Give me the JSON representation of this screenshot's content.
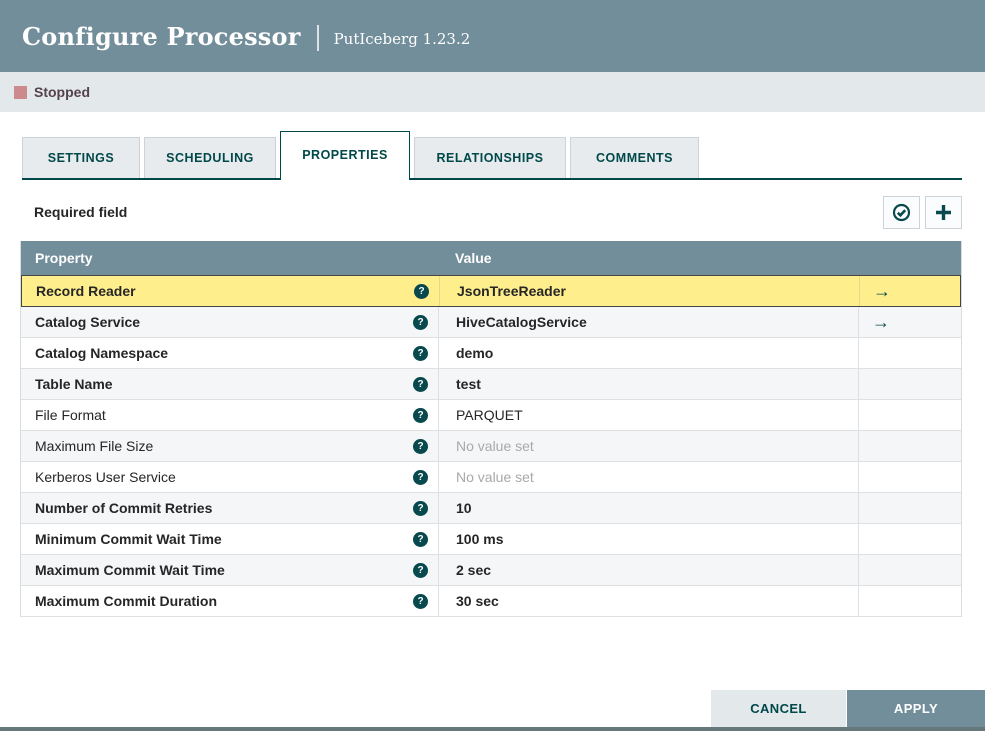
{
  "dialog": {
    "title": "Configure Processor",
    "subtitle": "PutIceberg 1.23.2"
  },
  "status": {
    "label": "Stopped",
    "color": "#CC8A8D"
  },
  "tabs": [
    {
      "label": "SETTINGS",
      "active": false
    },
    {
      "label": "SCHEDULING",
      "active": false
    },
    {
      "label": "PROPERTIES",
      "active": true
    },
    {
      "label": "RELATIONSHIPS",
      "active": false
    },
    {
      "label": "COMMENTS",
      "active": false
    }
  ],
  "toolbar": {
    "required_field_label": "Required field",
    "verify_icon": "check-circle-icon",
    "add_icon": "plus-icon"
  },
  "icons": {
    "help_glyph": "?",
    "arrow_glyph": "→"
  },
  "table": {
    "columns": {
      "property": "Property",
      "value": "Value"
    },
    "rows": [
      {
        "property": "Record Reader",
        "value": "JsonTreeReader",
        "required": true,
        "selected": true,
        "has_arrow": true,
        "value_set": true
      },
      {
        "property": "Catalog Service",
        "value": "HiveCatalogService",
        "required": true,
        "selected": false,
        "has_arrow": true,
        "value_set": true
      },
      {
        "property": "Catalog Namespace",
        "value": "demo",
        "required": true,
        "selected": false,
        "has_arrow": false,
        "value_set": true
      },
      {
        "property": "Table Name",
        "value": "test",
        "required": true,
        "selected": false,
        "has_arrow": false,
        "value_set": true
      },
      {
        "property": "File Format",
        "value": "PARQUET",
        "required": false,
        "selected": false,
        "has_arrow": false,
        "value_set": true
      },
      {
        "property": "Maximum File Size",
        "value": "No value set",
        "required": false,
        "selected": false,
        "has_arrow": false,
        "value_set": false
      },
      {
        "property": "Kerberos User Service",
        "value": "No value set",
        "required": false,
        "selected": false,
        "has_arrow": false,
        "value_set": false
      },
      {
        "property": "Number of Commit Retries",
        "value": "10",
        "required": true,
        "selected": false,
        "has_arrow": false,
        "value_set": true
      },
      {
        "property": "Minimum Commit Wait Time",
        "value": "100 ms",
        "required": true,
        "selected": false,
        "has_arrow": false,
        "value_set": true
      },
      {
        "property": "Maximum Commit Wait Time",
        "value": "2 sec",
        "required": true,
        "selected": false,
        "has_arrow": false,
        "value_set": true
      },
      {
        "property": "Maximum Commit Duration",
        "value": "30 sec",
        "required": true,
        "selected": false,
        "has_arrow": false,
        "value_set": true
      }
    ]
  },
  "footer": {
    "cancel_label": "CANCEL",
    "apply_label": "APPLY"
  },
  "colors": {
    "header_bg": "#728E9B",
    "status_bar_bg": "#E3E8EB",
    "accent_teal": "#004849",
    "selected_row": "#FFEE8C",
    "stripe_row": "#F4F6F8",
    "unset_text": "#A9A9A9"
  }
}
